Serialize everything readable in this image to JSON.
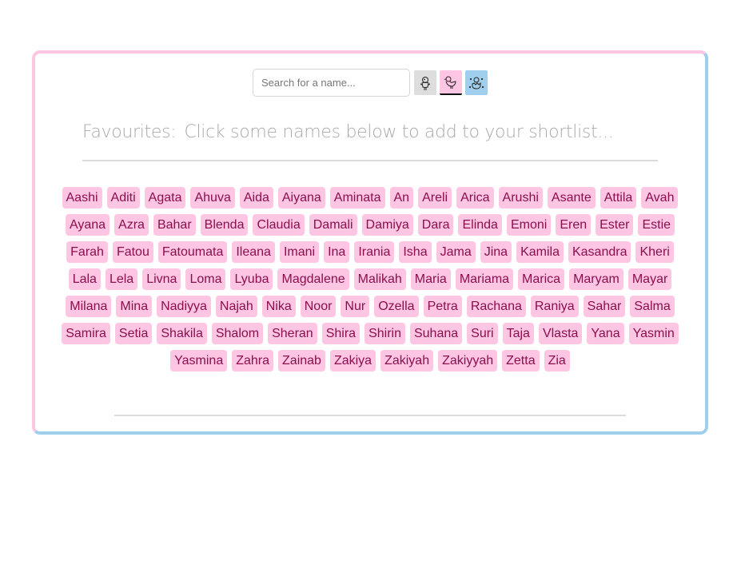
{
  "search": {
    "placeholder": "Search for a name..."
  },
  "modes": [
    {
      "icon": "chick-standing-icon",
      "color": "#dddddd",
      "active": false
    },
    {
      "icon": "chick-walking-icon",
      "color": "#ffc6e4",
      "active": true
    },
    {
      "icon": "hatching-chick-icon",
      "color": "#9fcfec",
      "active": false
    }
  ],
  "favourites": {
    "label": "Favourites:",
    "hint": "Click some names below to add to your shortlist..."
  },
  "names": [
    "Aashi",
    "Aditi",
    "Agata",
    "Ahuva",
    "Aida",
    "Aiyana",
    "Aminata",
    "An",
    "Areli",
    "Arica",
    "Arushi",
    "Asante",
    "Attila",
    "Avah",
    "Ayana",
    "Azra",
    "Bahar",
    "Blenda",
    "Claudia",
    "Damali",
    "Damiya",
    "Dara",
    "Elinda",
    "Emoni",
    "Eren",
    "Ester",
    "Estie",
    "Farah",
    "Fatou",
    "Fatoumata",
    "Ileana",
    "Imani",
    "Ina",
    "Irania",
    "Isha",
    "Jama",
    "Jina",
    "Kamila",
    "Kasandra",
    "Kheri",
    "Lala",
    "Lela",
    "Livna",
    "Loma",
    "Lyuba",
    "Magdalene",
    "Malikah",
    "Maria",
    "Mariama",
    "Marica",
    "Maryam",
    "Mayar",
    "Milana",
    "Mina",
    "Nadiyya",
    "Najah",
    "Nika",
    "Noor",
    "Nur",
    "Ozella",
    "Petra",
    "Rachana",
    "Raniya",
    "Sahar",
    "Salma",
    "Samira",
    "Setia",
    "Shakila",
    "Shalom",
    "Sheran",
    "Shira",
    "Shirin",
    "Suhana",
    "Suri",
    "Taja",
    "Vlasta",
    "Yana",
    "Yasmin",
    "Yasmina",
    "Zahra",
    "Zainab",
    "Zakiya",
    "Zakiyah",
    "Zakiyyah",
    "Zetta",
    "Zia"
  ],
  "colors": {
    "tag_bg": "#ffc6e4",
    "tag_text": "#8a0f4d",
    "border_pink": "#ffc6e4",
    "border_blue": "#9fcfec"
  }
}
